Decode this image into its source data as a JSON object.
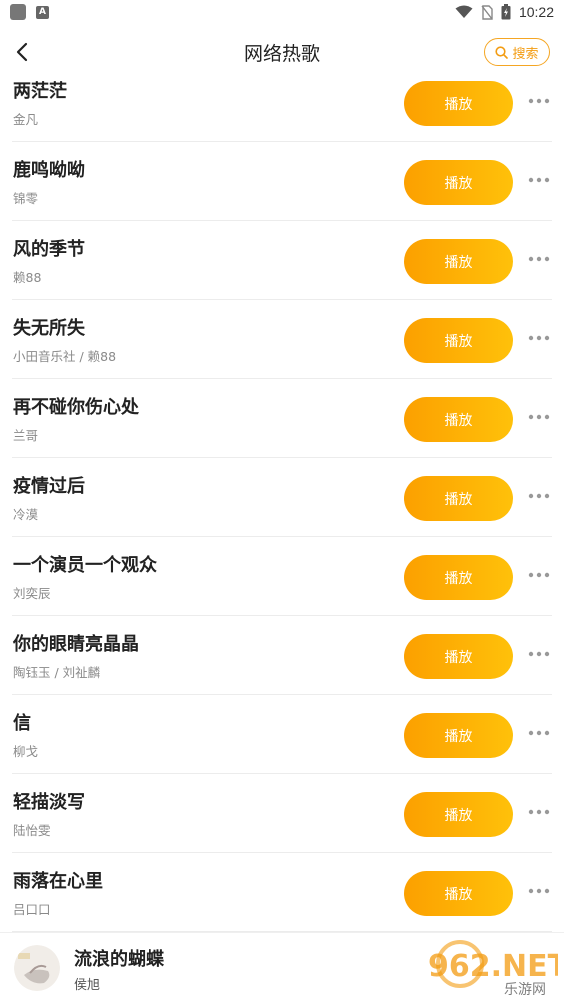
{
  "status_bar": {
    "time": "10:22",
    "icons": [
      "app-square-icon",
      "a-badge-icon",
      "wifi-icon",
      "no-sim-icon",
      "battery-charging-icon"
    ]
  },
  "header": {
    "back_icon": "chevron-left-icon",
    "title": "网络热歌",
    "search_label": "搜索",
    "search_icon": "search-icon",
    "accent": "#f5a623"
  },
  "songs": [
    {
      "title": "两茫茫",
      "artist": "金凡",
      "play_label": "播放"
    },
    {
      "title": "鹿鸣呦呦",
      "artist": "锦零",
      "play_label": "播放"
    },
    {
      "title": "风的季节",
      "artist": "赖88",
      "play_label": "播放"
    },
    {
      "title": "失无所失",
      "artist": "小田音乐社 / 赖88",
      "play_label": "播放"
    },
    {
      "title": "再不碰你伤心处",
      "artist": "兰哥",
      "play_label": "播放"
    },
    {
      "title": "疫情过后",
      "artist": "冷漠",
      "play_label": "播放"
    },
    {
      "title": "一个演员一个观众",
      "artist": "刘奕辰",
      "play_label": "播放"
    },
    {
      "title": "你的眼睛亮晶晶",
      "artist": "陶钰玉 / 刘祉麟",
      "play_label": "播放"
    },
    {
      "title": "信",
      "artist": "柳戈",
      "play_label": "播放"
    },
    {
      "title": "轻描淡写",
      "artist": "陆怡雯",
      "play_label": "播放"
    },
    {
      "title": "雨落在心里",
      "artist": "吕口口",
      "play_label": "播放"
    }
  ],
  "colors": {
    "play_gradient_start": "#fca000",
    "play_gradient_end": "#ffc10a",
    "more_dots": "#999999"
  },
  "now_playing": {
    "title": "流浪的蝴蝶",
    "artist": "侯旭",
    "cover_icon": "album-cover-image"
  },
  "watermark": {
    "main": "962.NET",
    "sub": "乐游网"
  }
}
